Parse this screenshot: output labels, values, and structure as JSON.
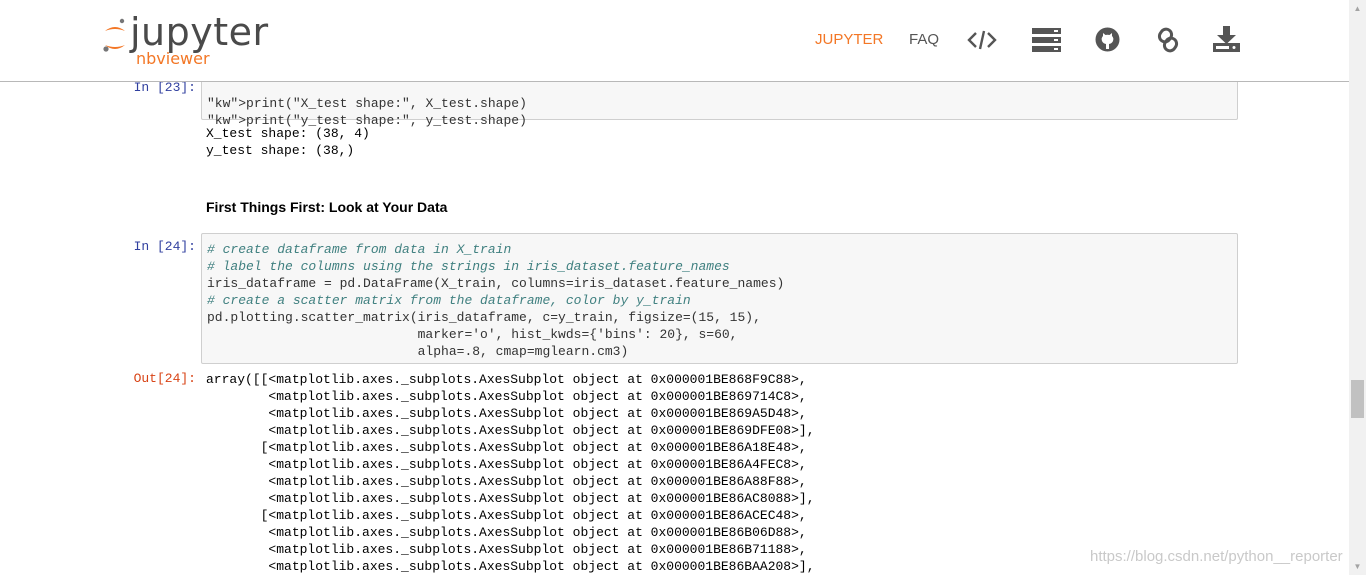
{
  "brand": {
    "wordmark": "jupyter",
    "subtitle": "nbviewer",
    "accent_color": "#f37726"
  },
  "nav": {
    "jupyter_link": "JUPYTER",
    "faq_link": "FAQ",
    "icons": [
      "code-icon",
      "server-icon",
      "github-icon",
      "link-icon",
      "download-icon"
    ]
  },
  "cells": {
    "cell23": {
      "prompt": "In  [23]:",
      "code": [
        "print(\"X_test shape:\", X_test.shape)",
        "print(\"y_test shape:\", y_test.shape)"
      ],
      "output": [
        "X_test shape: (38, 4)",
        "y_test shape: (38,)"
      ]
    },
    "markdown": {
      "heading": "First Things First: Look at Your Data"
    },
    "cell24": {
      "prompt": "In  [24]:",
      "code": [
        "# create dataframe from data in X_train",
        "# label the columns using the strings in iris_dataset.feature_names",
        "iris_dataframe = pd.DataFrame(X_train, columns=iris_dataset.feature_names)",
        "# create a scatter matrix from the dataframe, color by y_train",
        "pd.plotting.scatter_matrix(iris_dataframe, c=y_train, figsize=(15, 15),",
        "                           marker='o', hist_kwds={'bins': 20}, s=60,",
        "                           alpha=.8, cmap=mglearn.cm3)"
      ],
      "out_prompt": "Out[24]:",
      "output": [
        "array([[<matplotlib.axes._subplots.AxesSubplot object at 0x000001BE868F9C88>,",
        "        <matplotlib.axes._subplots.AxesSubplot object at 0x000001BE869714C8>,",
        "        <matplotlib.axes._subplots.AxesSubplot object at 0x000001BE869A5D48>,",
        "        <matplotlib.axes._subplots.AxesSubplot object at 0x000001BE869DFE08>],",
        "       [<matplotlib.axes._subplots.AxesSubplot object at 0x000001BE86A18E48>,",
        "        <matplotlib.axes._subplots.AxesSubplot object at 0x000001BE86A4FEC8>,",
        "        <matplotlib.axes._subplots.AxesSubplot object at 0x000001BE86A88F88>,",
        "        <matplotlib.axes._subplots.AxesSubplot object at 0x000001BE86AC8088>],",
        "       [<matplotlib.axes._subplots.AxesSubplot object at 0x000001BE86ACEC48>,",
        "        <matplotlib.axes._subplots.AxesSubplot object at 0x000001BE86B06D88>,",
        "        <matplotlib.axes._subplots.AxesSubplot object at 0x000001BE86B71188>,",
        "        <matplotlib.axes._subplots.AxesSubplot object at 0x000001BE86BAA208>],"
      ]
    }
  },
  "watermark": "https://blog.csdn.net/python__reporter"
}
